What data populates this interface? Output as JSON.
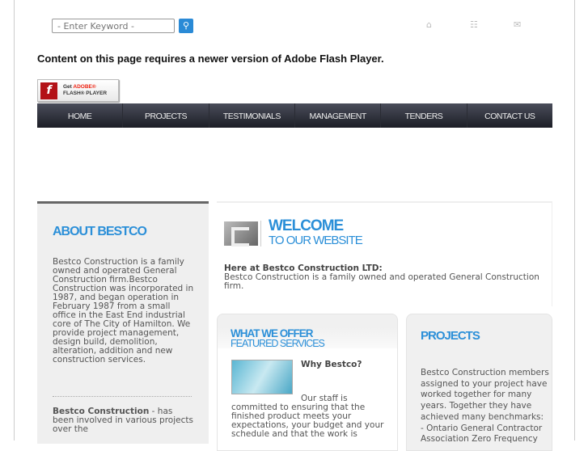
{
  "search": {
    "placeholder": "- Enter Keyword -",
    "button_icon": "search-icon"
  },
  "top_icons": [
    "home-icon",
    "sitemap-icon",
    "mail-icon"
  ],
  "flash": {
    "message": "Content on this page requires a newer version of Adobe Flash Player.",
    "badge_get": "Get",
    "badge_adobe": "ADOBE®",
    "badge_player": "FLASH® PLAYER"
  },
  "nav": [
    "HOME",
    "PROJECTS",
    "TESTIMONIALS",
    "MANAGEMENT",
    "TENDERS",
    "CONTACT US"
  ],
  "about": {
    "title": "ABOUT BESTCO",
    "text": "Bestco Construction is a family owned and operated General Construction firm.Bestco Construction was incorporated in 1987, and began operation in February 1987 from a small office in the East End industrial core of The City of Hamilton. We provide project management, design build, demolition, alteration, addition and new construction services.",
    "bold2": "Bestco Construction",
    "text2": " - has been involved in various projects over the"
  },
  "welcome": {
    "line1": "WELCOME",
    "line2": "TO OUR WEBSITE",
    "subtitle": "Here at Bestco Construction LTD:",
    "text": "Bestco Construction is a family owned and operated General Construction firm."
  },
  "offer": {
    "title": "WHAT WE OFFER",
    "subtitle": "FEATURED SERVICES",
    "heading": "Why Bestco?",
    "text": "Our staff is committed to ensuring that the finished product meets your expectations, your budget and your schedule and that the work is"
  },
  "projects": {
    "title": "PROJECTS",
    "text": "Bestco Construction members assigned to your project have worked together for many years. Together they have achieved many benchmarks:",
    "item": "- Ontario General Contractor Association Zero Frequency"
  }
}
